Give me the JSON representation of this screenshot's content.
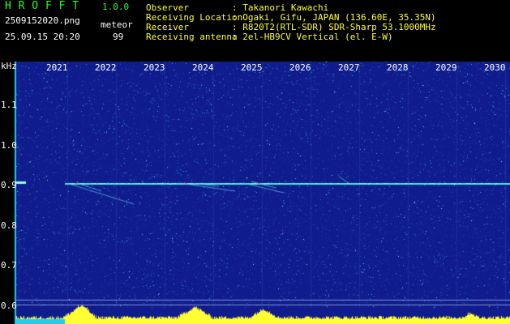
{
  "app": {
    "title": "H R O F F T",
    "version": "1.0.0"
  },
  "capture": {
    "file_name": "2509152020.png",
    "datetime": "25.09.15 20:20",
    "meteor_label": "meteor",
    "meteor_count": "99"
  },
  "info": [
    {
      "label": "Observer",
      "value": ": Takanori Kawachi"
    },
    {
      "label": "Receiving Location",
      "value": ": Ogaki, Gifu, JAPAN (136.60E, 35.35N)"
    },
    {
      "label": "Receiver",
      "value": ": R820T2(RTL-SDR) SDR-Sharp 53.1000MHz"
    },
    {
      "label": "Receiving antenna",
      "value": ": 2el-HB9CV Vertical (el. E-W)"
    }
  ],
  "spectrogram": {
    "unit": "kHz",
    "x_ticks": [
      "2021",
      "2022",
      "2023",
      "2024",
      "2025",
      "2026",
      "2027",
      "2028",
      "2029",
      "2030"
    ],
    "y_ticks": [
      "1.1",
      "1.0",
      "0.9",
      "0.8",
      "0.7",
      "0.6"
    ],
    "colors": {
      "background": "#101c8c",
      "carrier": "#4de8e0",
      "level_bar": "#ffff33",
      "low_band": "#22ccee"
    }
  }
}
